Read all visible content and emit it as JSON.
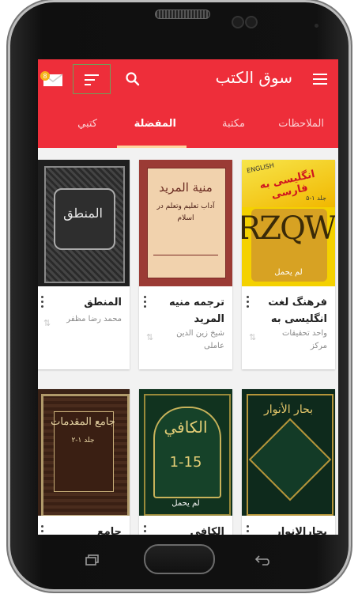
{
  "app": {
    "title": "سوق الكتب"
  },
  "tabs": [
    {
      "label": "الملاحظات",
      "active": false
    },
    {
      "label": "مكتبة",
      "active": false
    },
    {
      "label": "المفضلة",
      "active": true
    },
    {
      "label": "كتبي",
      "active": false
    }
  ],
  "colors": {
    "accent": "#ee2e3a",
    "tab_indicator": "#ffd6a0",
    "sort_highlight": "#6fa05a"
  },
  "icons": {
    "menu": "menu-icon",
    "search": "search-icon",
    "sort": "sort-icon",
    "mail": "mail-icon",
    "overflow": "more-vert-icon",
    "download": "download-icon"
  },
  "books": [
    {
      "title": "فرهنگ لغت انگلیسی به",
      "author": "واحد تحقیقات مرکز",
      "cover_text": "انگلیسی به فارسی",
      "cover_top_text": "ENGLISH",
      "cover_volume": "جلد ۱-۵",
      "cover_letters": "RZQW",
      "badge": "لم يحمل"
    },
    {
      "title": "ترجمه منیه المريد",
      "author": "شیخ زین الدين عاملى",
      "cover_text": "منية المريد",
      "cover_subtitle": "آداب تعليم وتعلم در اسلام",
      "badge": ""
    },
    {
      "title": "المنطق",
      "author": "محمد رضا مظفر",
      "cover_text": "المنطق",
      "badge": ""
    },
    {
      "title": "بحارالانوار",
      "author": "",
      "cover_text": "بحار الأنوار",
      "badge": ""
    },
    {
      "title": "الكافى",
      "author": "",
      "cover_text": "الكافي",
      "cover_volume": "1-15",
      "badge": "لم يحمل"
    },
    {
      "title": "جامع",
      "author": "",
      "cover_text": "جامع المقدمات",
      "cover_volume": "جلد ۱-۲",
      "badge": ""
    }
  ]
}
